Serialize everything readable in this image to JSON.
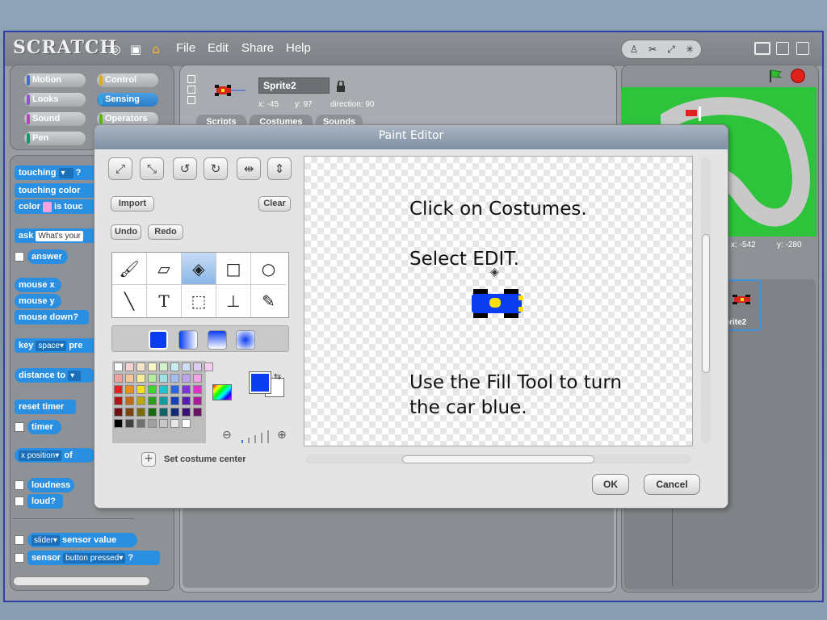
{
  "app": {
    "logo": "SCRATCH",
    "menus": [
      "File",
      "Edit",
      "Share",
      "Help"
    ]
  },
  "categories": [
    {
      "label": "Motion",
      "color": "#4a6cd4"
    },
    {
      "label": "Control",
      "color": "#e1a91a"
    },
    {
      "label": "Looks",
      "color": "#8a55d7"
    },
    {
      "label": "Sensing",
      "color": "#2ca5e2"
    },
    {
      "label": "Sound",
      "color": "#bb42c3"
    },
    {
      "label": "Operators",
      "color": "#5cb712"
    },
    {
      "label": "Pen",
      "color": "#0e9a6c"
    }
  ],
  "blocks": {
    "touching": "touching",
    "touching_q": "?",
    "touching_color": "touching color",
    "color": "color",
    "is_touching": "is touc",
    "ask": "ask",
    "ask_input": "What's your",
    "answer": "answer",
    "mouse_x": "mouse x",
    "mouse_y": "mouse y",
    "mouse_down": "mouse down?",
    "key": "key",
    "key_input": "space",
    "key_pressed": "pre",
    "distance_to": "distance to",
    "reset_timer": "reset timer",
    "timer": "timer",
    "x_position": "x position",
    "of": "of",
    "loudness": "loudness",
    "loud": "loud?",
    "slider": "slider",
    "sensor_value": "sensor value",
    "sensor": "sensor",
    "button_pressed": "button pressed",
    "sensor_q": "?"
  },
  "sprite": {
    "name": "Sprite2",
    "x_label": "x:",
    "x": "-45",
    "y_label": "y:",
    "y": "97",
    "direction_label": "direction:",
    "direction": "90",
    "tabs": [
      "Scripts",
      "Costumes",
      "Sounds"
    ]
  },
  "stage": {
    "mouse_x_label": "x:",
    "mouse_x": "-542",
    "mouse_y_label": "y:",
    "mouse_y": "-280",
    "thumb_label": "prite2"
  },
  "paint_editor": {
    "title": "Paint Editor",
    "import": "Import",
    "clear": "Clear",
    "undo": "Undo",
    "redo": "Redo",
    "set_center": "Set costume center",
    "ok": "OK",
    "cancel": "Cancel",
    "canvas_text_1": "Click on Costumes.",
    "canvas_text_2": "Select EDIT.",
    "canvas_text_3": "Use the Fill Tool to turn\nthe car blue.",
    "primary_color": "#0a3cf0",
    "secondary_color": "#ffffff"
  },
  "palette": [
    [
      "#ffffff",
      "#f6d3d3",
      "#f7e6cc",
      "#fbf6c6",
      "#d3f3cc",
      "#c9eef0",
      "#cfdcf6",
      "#dccdf3",
      "#f4cdef"
    ],
    [
      "#f0a2a2",
      "#f6c79a",
      "#f6ef93",
      "#b4ec9f",
      "#9ee3e6",
      "#a3bdf0",
      "#bda4ec",
      "#eca4e2"
    ],
    [
      "#e02222",
      "#f08c1a",
      "#f0e11a",
      "#3cd62a",
      "#1ec4cc",
      "#2a62e6",
      "#7a32dc",
      "#dc32c8"
    ],
    [
      "#b01616",
      "#c46a10",
      "#b8a810",
      "#28a01a",
      "#129aa0",
      "#1a40b8",
      "#561cb0",
      "#a81c98"
    ],
    [
      "#701010",
      "#7c440c",
      "#766c0c",
      "#186a12",
      "#0e6468",
      "#102a78",
      "#381274",
      "#6c1262"
    ],
    [
      "#000000",
      "#404040",
      "#707070",
      "#a0a0a0",
      "#c8c8c8",
      "#e6e6e6",
      "#ffffff"
    ]
  ]
}
